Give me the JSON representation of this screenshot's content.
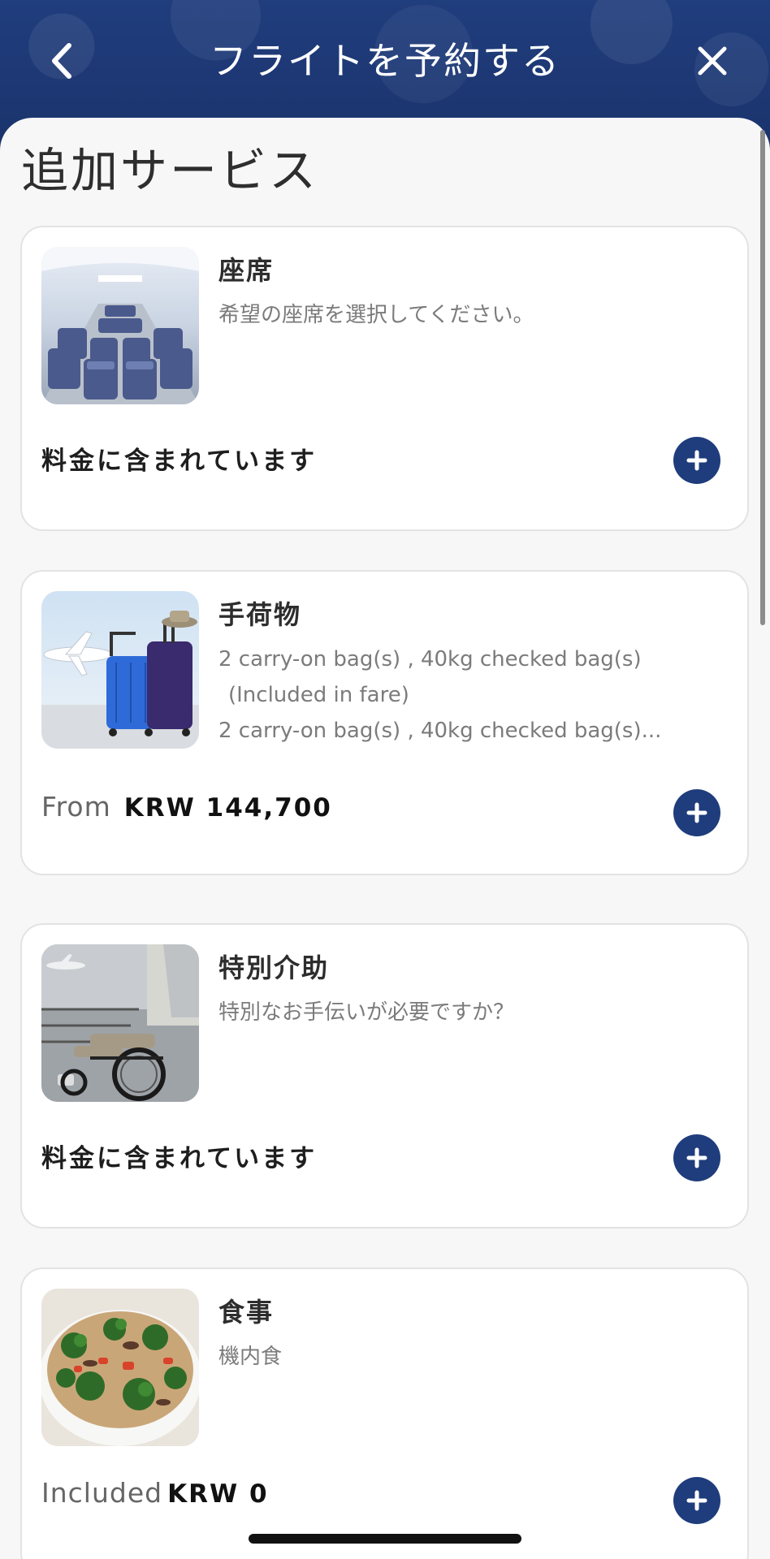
{
  "header": {
    "title": "フライトを予約する",
    "back_icon": "chevron-left-icon",
    "close_icon": "close-icon"
  },
  "section_title": "追加サービス",
  "cards": [
    {
      "title": "座席",
      "description_lines": [
        "希望の座席を選択してください。"
      ],
      "price": {
        "included_text": "料金に含まれています"
      },
      "image": "airplane-cabin-seats"
    },
    {
      "title": "手荷物",
      "description_lines": [
        "2 carry-on bag(s) , 40kg checked bag(s)",
        "(Included in fare)",
        "2 carry-on bag(s) , 40kg checked bag(s)..."
      ],
      "price": {
        "prefix": "From",
        "amount": "KRW 144,700"
      },
      "image": "luggage-suitcases"
    },
    {
      "title": "特別介助",
      "description_lines": [
        "特別なお手伝いが必要ですか？"
      ],
      "price": {
        "included_text": "料金に含まれています"
      },
      "image": "wheelchair-assistance"
    },
    {
      "title": "食事",
      "description_lines": [
        "機内食"
      ],
      "price": {
        "prefix": "Included",
        "amount": "KRW 0"
      },
      "image": "meal-bowl"
    }
  ],
  "colors": {
    "primary": "#1f3d7c",
    "header_bg": "#1f3b78",
    "background": "#f7f7f7",
    "card_border": "#e3e3e3"
  }
}
